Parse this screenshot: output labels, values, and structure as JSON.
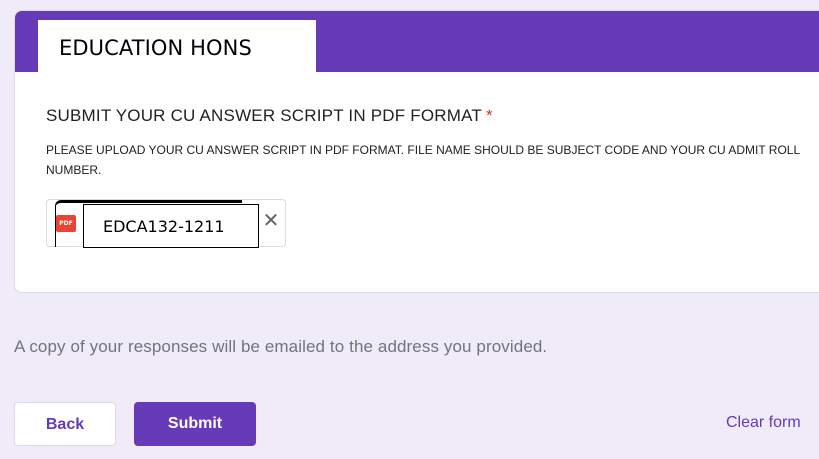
{
  "section": {
    "label": "EDUCATION HONS"
  },
  "question": {
    "title": "SUBMIT YOUR CU ANSWER SCRIPT IN PDF FORMAT",
    "required_mark": "*",
    "description": "PLEASE UPLOAD YOUR CU ANSWER SCRIPT IN PDF FORMAT. FILE NAME SHOULD BE SUBJECT CODE AND YOUR CU ADMIT ROLL NUMBER."
  },
  "file": {
    "icon": "pdf-file-icon",
    "icon_label": "PDF",
    "name": "EDCA132-1211",
    "remove_glyph": "✕"
  },
  "footer": {
    "email_note": "A copy of your responses will be emailed to the address you provided.",
    "back_label": "Back",
    "submit_label": "Submit",
    "clear_label": "Clear form"
  },
  "colors": {
    "accent": "#673ab7",
    "background": "#efebf8",
    "required": "#d93025",
    "pdf_icon": "#ea4335"
  }
}
